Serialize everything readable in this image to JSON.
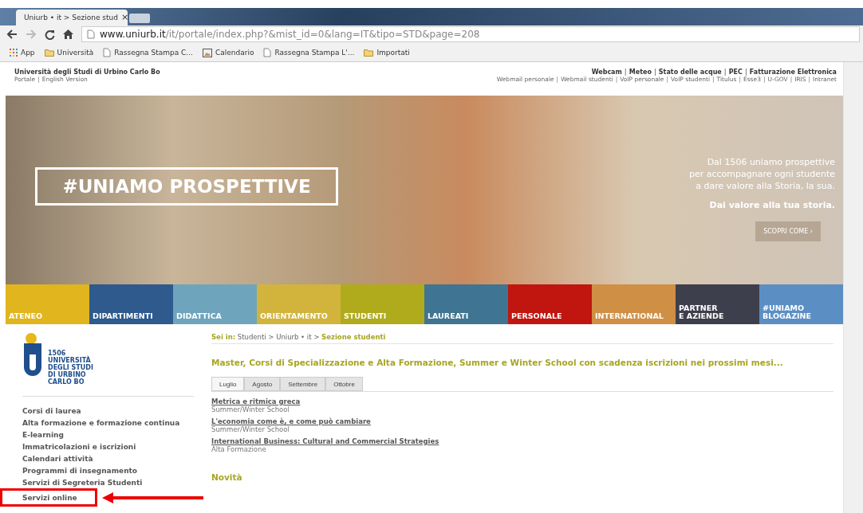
{
  "browser": {
    "tab_title": "Uniurb • it > Sezione stud",
    "tab_close": "×",
    "url_host": "www.uniurb.it",
    "url_path": "/it/portale/index.php?&mist_id=0&lang=IT&tipo=STD&page=208",
    "bookmarks": [
      {
        "kind": "apps",
        "label": "App"
      },
      {
        "kind": "folder",
        "label": "Università"
      },
      {
        "kind": "page",
        "label": "Rassegna Stampa C..."
      },
      {
        "kind": "image",
        "label": "Calendario"
      },
      {
        "kind": "page",
        "label": "Rassegna Stampa L'..."
      },
      {
        "kind": "folder",
        "label": "Importati"
      }
    ]
  },
  "header": {
    "separator": "|",
    "site_name": "Università degli Studi di Urbino Carlo Bo",
    "lang_links": [
      "Portale",
      "English Version"
    ],
    "top_links": [
      "Webcam",
      "Meteo",
      "Stato delle acque",
      "PEC",
      "Fatturazione Elettronica"
    ],
    "service_links": [
      "Webmail personale",
      "Webmail studenti",
      "VoIP personale",
      "VoIP studenti",
      "Titulus",
      "Esse3",
      "U-GOV",
      "IRIS",
      "Intranet"
    ]
  },
  "hero": {
    "headline": "#UNIAMO PROSPETTIVE",
    "lines": [
      "Dal 1506 uniamo prospettive",
      "per accompagnare ogni studente",
      "a dare valore alla Storia, la sua."
    ],
    "tagline": "Dai valore alla tua storia.",
    "button": "SCOPRI COME ›"
  },
  "nav": [
    {
      "label": "ATENEO",
      "color": "#e0b51e"
    },
    {
      "label": "DIPARTIMENTI",
      "color": "#2e5a8e"
    },
    {
      "label": "DIDATTICA",
      "color": "#6ea5bd"
    },
    {
      "label": "ORIENTAMENTO",
      "color": "#d2b43c"
    },
    {
      "label": "STUDENTI",
      "color": "#b0ab1c"
    },
    {
      "label": "LAUREATI",
      "color": "#3f7592"
    },
    {
      "label": "PERSONALE",
      "color": "#c0160f"
    },
    {
      "label": "INTERNATIONAL",
      "color": "#cf8f45"
    },
    {
      "label": "PARTNER\nE AZIENDE",
      "color": "#3e3f4c"
    },
    {
      "label": "#UNIAMO\nBLOGAZINE",
      "color": "#5b8fc4"
    }
  ],
  "logo": {
    "year": "1506",
    "lines": [
      "UNIVERSITÀ",
      "DEGLI STUDI",
      "DI URBINO",
      "CARLO BO"
    ]
  },
  "sidebar": {
    "items": [
      {
        "label": "Corsi di laurea",
        "highlighted": false
      },
      {
        "label": "Alta formazione e formazione continua",
        "highlighted": false
      },
      {
        "label": "E-learning",
        "highlighted": false
      },
      {
        "label": "Immatricolazioni e iscrizioni",
        "highlighted": false
      },
      {
        "label": "Calendari attività",
        "highlighted": false
      },
      {
        "label": "Programmi di insegnamento",
        "highlighted": false
      },
      {
        "label": "Servizi di Segreteria Studenti",
        "highlighted": false
      },
      {
        "label": "Servizi online",
        "highlighted": true
      }
    ]
  },
  "breadcrumb": {
    "separator": ">",
    "prefix": "Sei in:",
    "path": [
      "Studenti",
      "Uniurb • it"
    ],
    "current": "Sezione studenti"
  },
  "section_title": "Master, Corsi di Specializzazione e Alta Formazione, Summer e Winter School con scadenza iscrizioni nei prossimi mesi...",
  "tabs": [
    {
      "label": "Luglio",
      "selected": true
    },
    {
      "label": "Agosto",
      "selected": false
    },
    {
      "label": "Settembre",
      "selected": false
    },
    {
      "label": "Ottobre",
      "selected": false
    }
  ],
  "courses": [
    {
      "title": "Metrica e ritmica greca",
      "type": "Summer/Winter School"
    },
    {
      "title": "L'economia come è, e come può cambiare",
      "type": "Summer/Winter School"
    },
    {
      "title": "International Business: Cultural and Commercial Strategies",
      "type": "Alta Formazione"
    }
  ],
  "news_title": "Novità"
}
